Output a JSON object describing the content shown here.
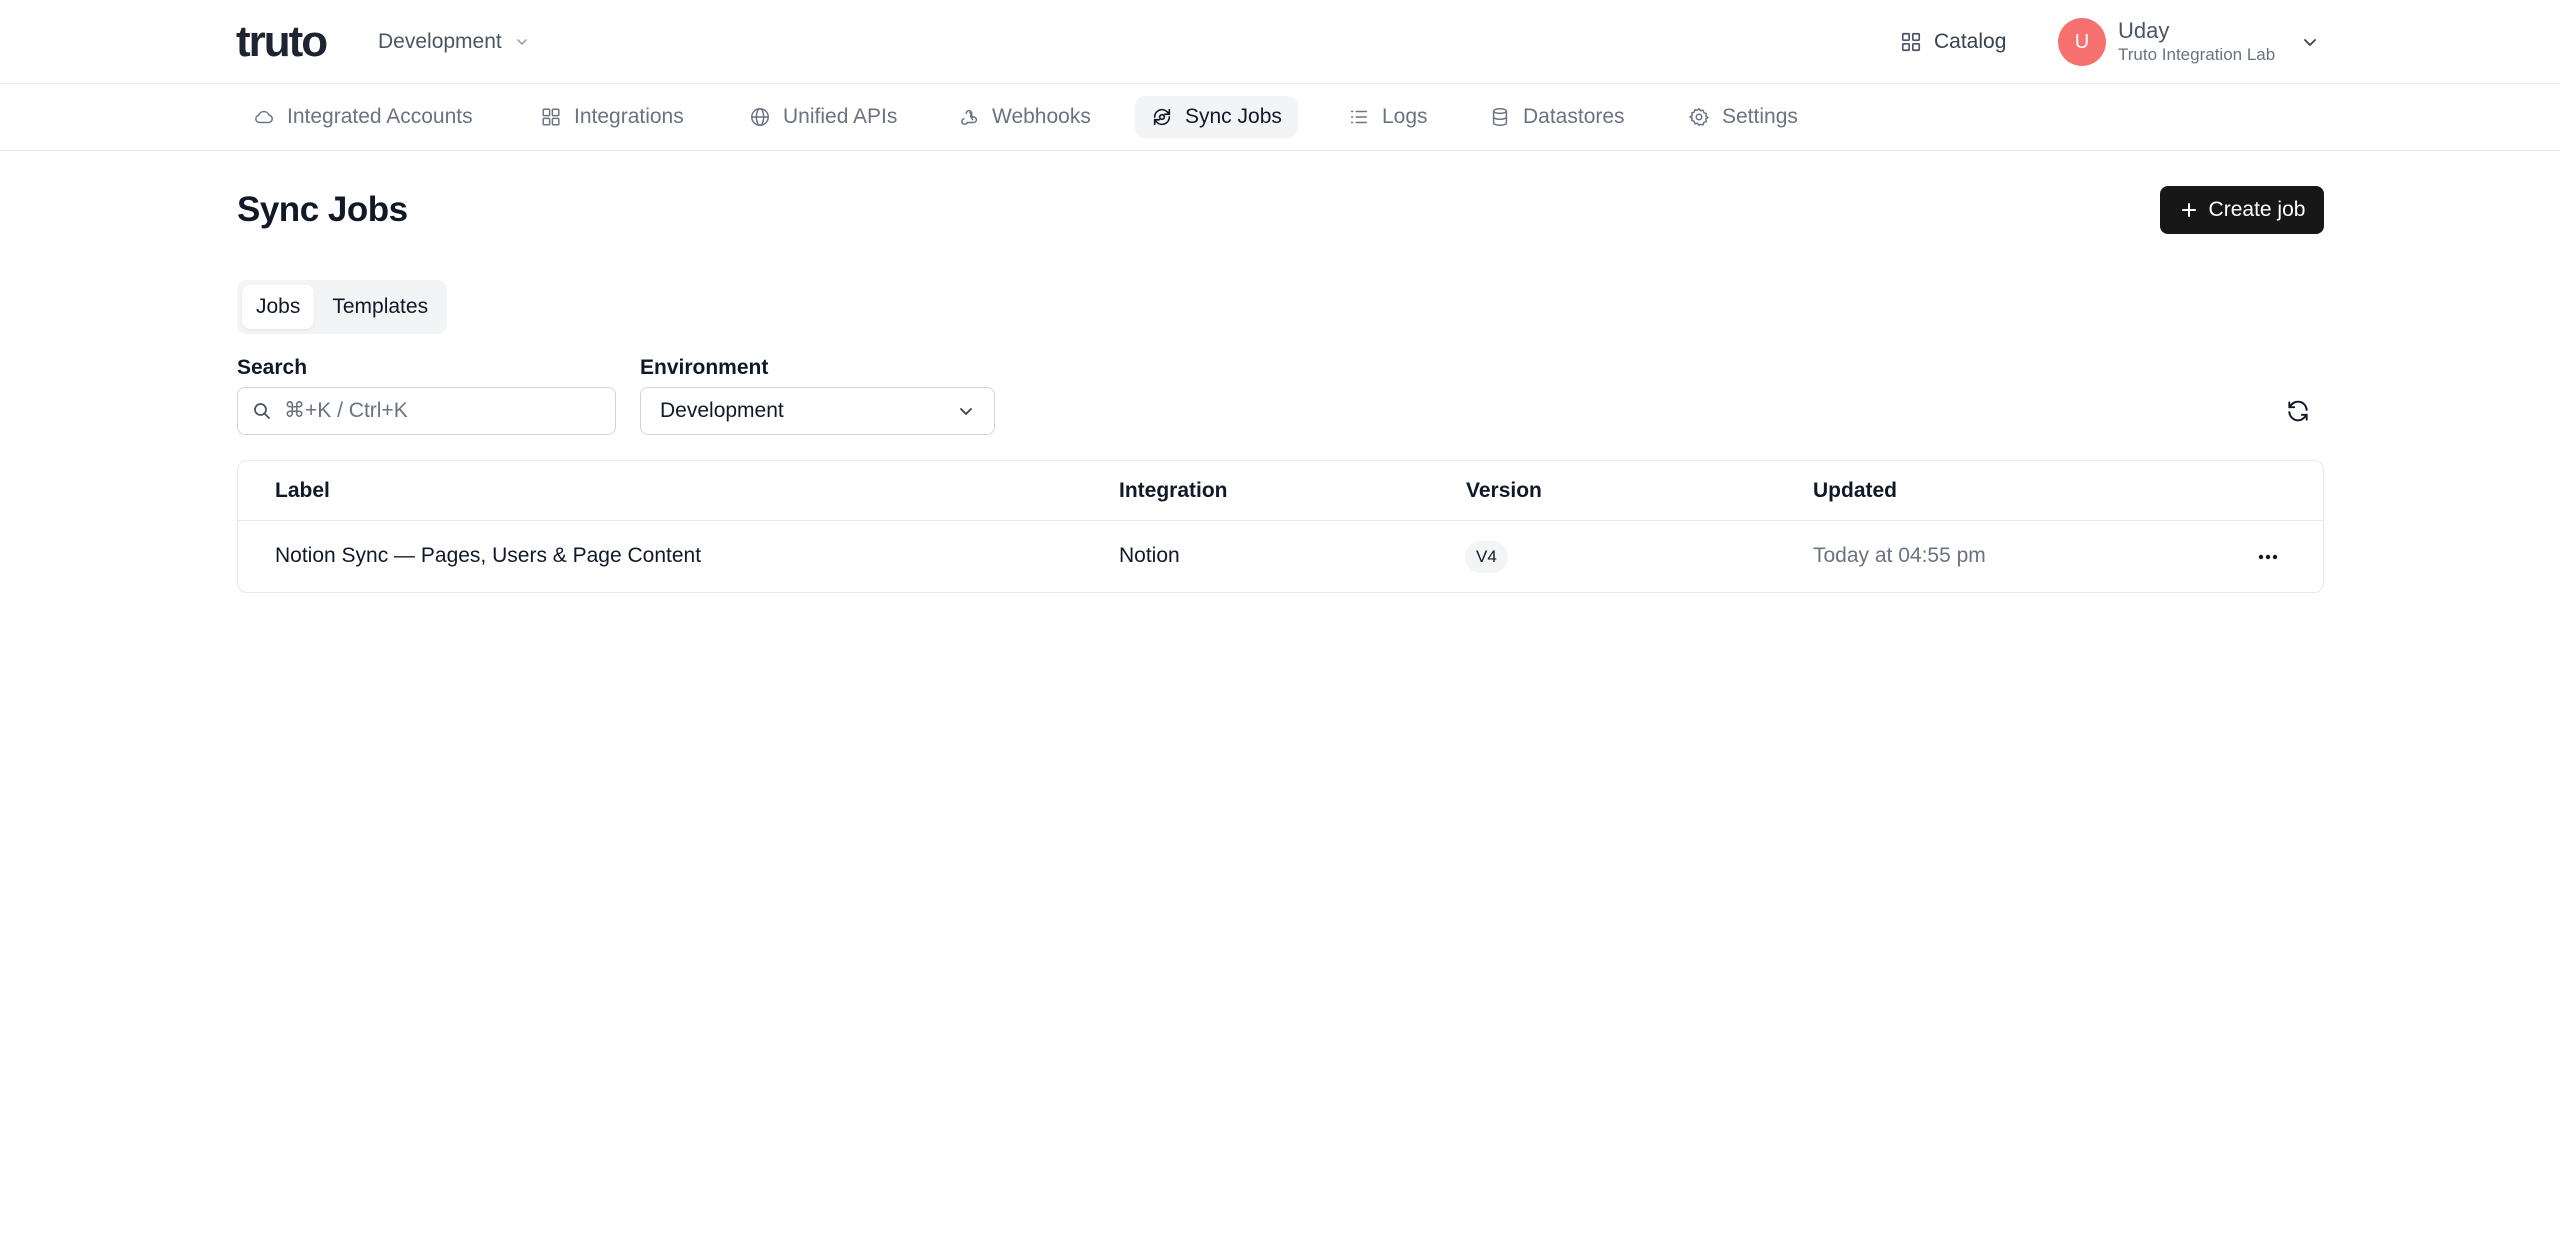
{
  "header": {
    "logo_text": "truto",
    "environment": "Development",
    "catalog_label": "Catalog",
    "user": {
      "initial": "U",
      "name": "Uday",
      "org": "Truto Integration Lab"
    }
  },
  "nav": {
    "items": [
      {
        "label": "Integrated Accounts",
        "icon": "cloud-icon"
      },
      {
        "label": "Integrations",
        "icon": "grid-icon"
      },
      {
        "label": "Unified APIs",
        "icon": "globe-icon"
      },
      {
        "label": "Webhooks",
        "icon": "webhook-icon"
      },
      {
        "label": "Sync Jobs",
        "icon": "sync-icon",
        "active": true
      },
      {
        "label": "Logs",
        "icon": "list-icon"
      },
      {
        "label": "Datastores",
        "icon": "database-icon"
      },
      {
        "label": "Settings",
        "icon": "gear-icon"
      }
    ]
  },
  "page": {
    "title": "Sync Jobs",
    "create_label": "Create job",
    "tabs": [
      {
        "label": "Jobs",
        "active": true
      },
      {
        "label": "Templates"
      }
    ],
    "filters": {
      "search_label": "Search",
      "search_placeholder": "⌘+K / Ctrl+K",
      "search_value": "",
      "environment_label": "Environment",
      "environment_value": "Development"
    }
  },
  "table": {
    "columns": [
      "Label",
      "Integration",
      "Version",
      "Updated"
    ],
    "rows": [
      {
        "label": "Notion Sync — Pages, Users & Page Content",
        "integration": "Notion",
        "version": "V4",
        "updated": "Today at 04:55 pm"
      }
    ]
  },
  "colors": {
    "primary_button": "#171717",
    "avatar": "#f87171",
    "active_nav_bg": "#f3f4f6",
    "border": "#e5e7eb"
  }
}
